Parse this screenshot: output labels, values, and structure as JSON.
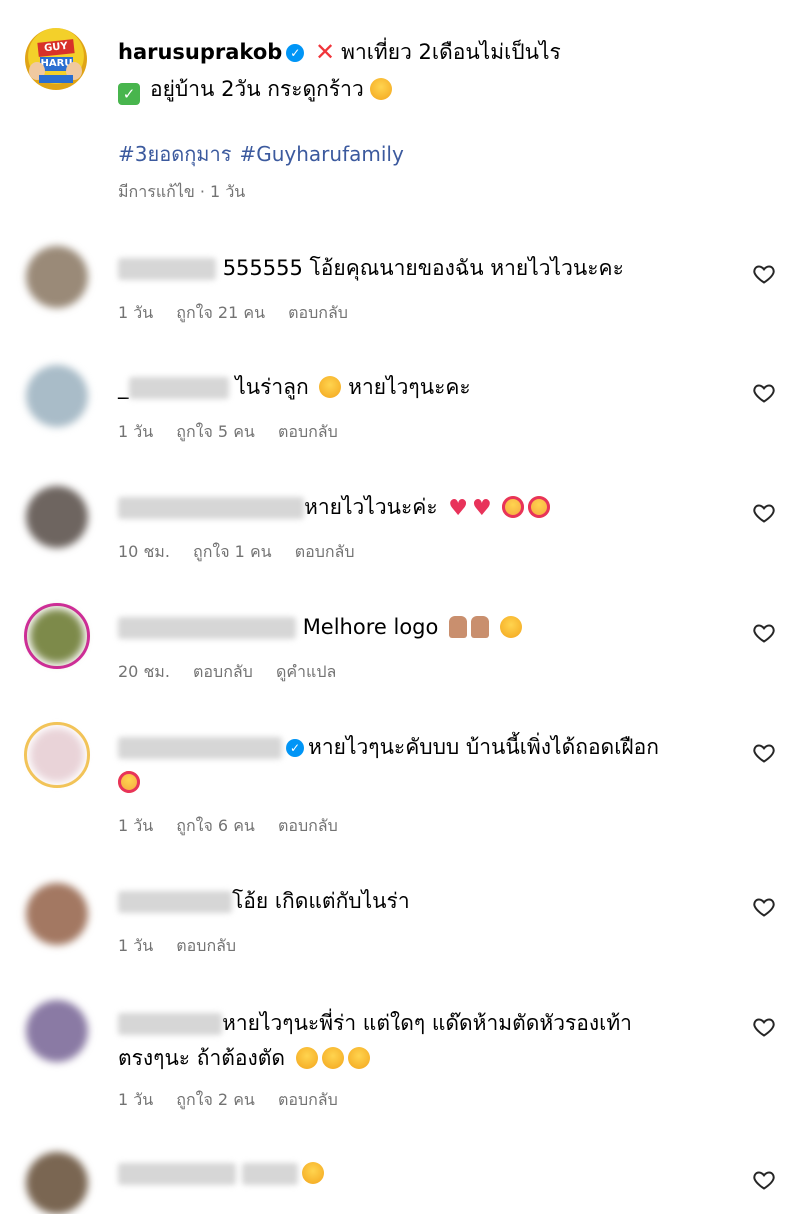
{
  "post": {
    "username": "harusuprakob",
    "caption_line1": "พาเที่ยว 2เดือนไม่เป็นไร",
    "caption_line2": "อยู่บ้าน 2วัน กระดูกร้าว",
    "hashtags": [
      "#3ยอดกุมาร",
      "#Guyharufamily"
    ],
    "edited": "มีการแก้ไข · 1 วัน",
    "avatar_text_top": "GUY",
    "avatar_text_bottom": "HARU"
  },
  "comments": [
    {
      "prefix": "",
      "text": "555555 โอ้ยคุณนายของฉัน หายไวไวนะคะ",
      "time": "1 วัน",
      "likes": "ถูกใจ 21 คน",
      "reply": "ตอบกลับ",
      "translate": ""
    },
    {
      "prefix": "_",
      "text": "ไนร่าลูก",
      "text2": "หายไวๆนะคะ",
      "time": "1 วัน",
      "likes": "ถูกใจ 5 คน",
      "reply": "ตอบกลับ",
      "translate": ""
    },
    {
      "prefix": "",
      "text": "หายไวไวนะค่ะ",
      "time": "10 ชม.",
      "likes": "ถูกใจ 1 คน",
      "reply": "ตอบกลับ",
      "translate": ""
    },
    {
      "prefix": "",
      "text": "Melhore logo",
      "time": "20 ชม.",
      "likes": "",
      "reply": "ตอบกลับ",
      "translate": "ดูคำแปล"
    },
    {
      "prefix": "",
      "text": "หายไวๆนะคับบบ บ้านนี้เพิ่งได้ถอดเฝือก",
      "time": "1 วัน",
      "likes": "ถูกใจ 6 คน",
      "reply": "ตอบกลับ",
      "translate": ""
    },
    {
      "prefix": "",
      "text": "โอ้ย เกิดแต่กับไนร่า",
      "time": "1 วัน",
      "likes": "",
      "reply": "ตอบกลับ",
      "translate": ""
    },
    {
      "prefix": "",
      "text": "หายไวๆนะพี่ร่า แต่ใดๆ แด๊ดห้ามตัดหัวรองเท้า",
      "text2": "ตรงๆนะ ถ้าต้องตัด",
      "time": "1 วัน",
      "likes": "ถูกใจ 2 คน",
      "reply": "ตอบกลับ",
      "translate": ""
    },
    {
      "prefix": "",
      "text": "",
      "time": "",
      "likes": "",
      "reply": "",
      "translate": ""
    }
  ],
  "icons": {
    "verified": "verified-badge-icon",
    "like": "heart-outline-icon"
  },
  "colors": {
    "link": "#3c5a9e",
    "meta": "#737373",
    "verified": "#0095f6",
    "story_ring": "#d6249f"
  }
}
